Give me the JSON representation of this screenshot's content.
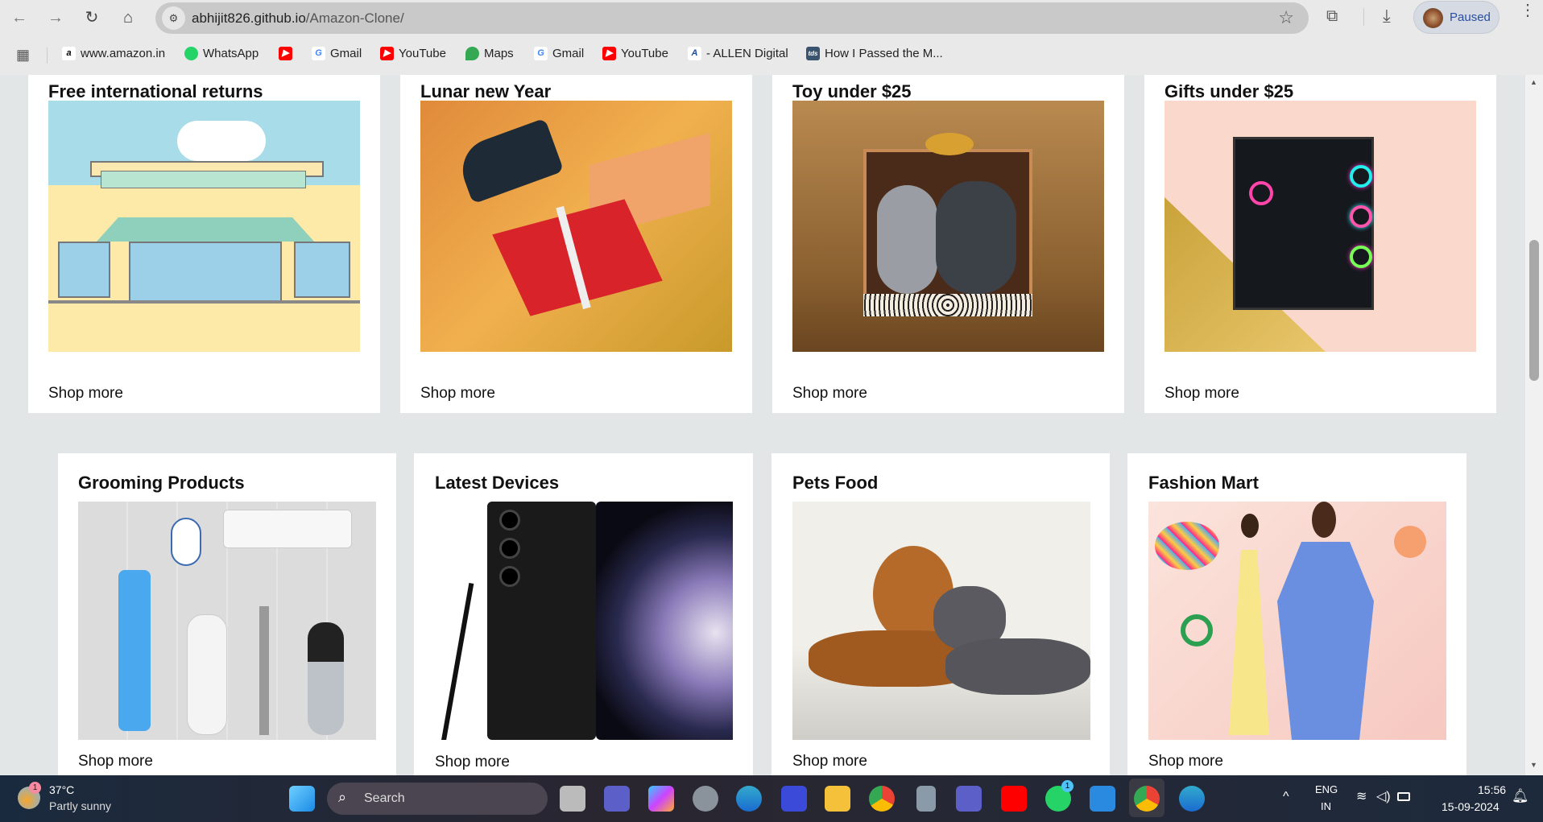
{
  "browser": {
    "url_host": "abhijit826.github.io",
    "url_path": "/Amazon-Clone/",
    "profile_status": "Paused",
    "bookmarks": [
      "www.amazon.in",
      "WhatsApp",
      "",
      "Gmail",
      "YouTube",
      "Maps",
      "Gmail",
      "YouTube",
      "- ALLEN Digital",
      "How I Passed the M..."
    ]
  },
  "row1": [
    {
      "title": "Free international returns",
      "link": "Shop more"
    },
    {
      "title": "Lunar new Year",
      "link": "Shop more"
    },
    {
      "title": "Toy under $25",
      "link": "Shop more"
    },
    {
      "title": "Gifts under $25",
      "link": "Shop more"
    }
  ],
  "row2": [
    {
      "title": "Grooming Products",
      "link": "Shop more"
    },
    {
      "title": "Latest Devices",
      "link": "Shop more"
    },
    {
      "title": "Pets Food",
      "link": "Shop more"
    },
    {
      "title": "Fashion Mart",
      "link": "Shop more"
    }
  ],
  "taskbar": {
    "temp": "37°C",
    "weather": "Partly sunny",
    "search": "Search",
    "lang1": "ENG",
    "lang2": "IN",
    "time": "15:56",
    "date": "15-09-2024",
    "weather_badge": "1",
    "whatsapp_badge": "1"
  }
}
